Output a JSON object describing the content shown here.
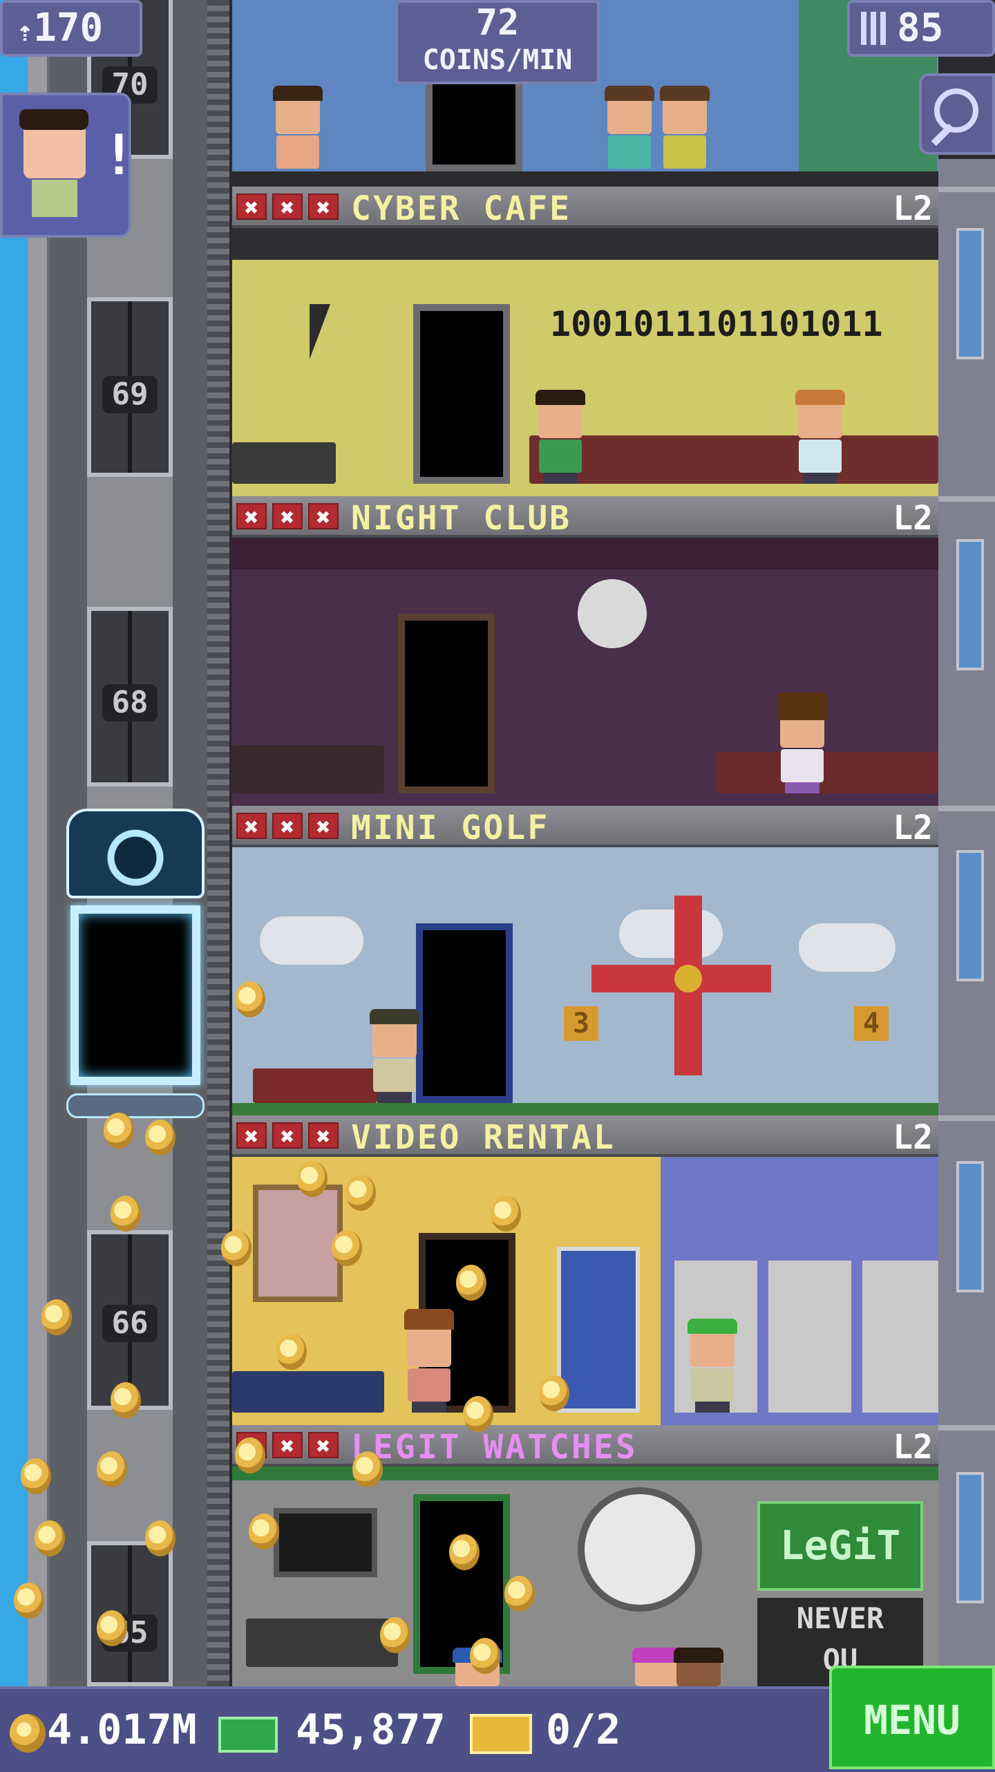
{
  "top_bar": {
    "population": "170",
    "coins_per_min_value": "72",
    "coins_per_min_label": "COINS/MIN",
    "floors_count": "85",
    "population_icon": "person-up-icon",
    "floors_icon": "building-icon",
    "search_icon": "magnifier-icon"
  },
  "notification": {
    "mark": "!"
  },
  "elevator_floor_numbers": [
    "70",
    "69",
    "68",
    "66",
    "65"
  ],
  "floors": [
    {
      "name": "CYBER CAFE",
      "level": "L2",
      "name_color": "#f3f1a2",
      "stock": [
        "✖",
        "✖",
        "✖"
      ],
      "screen_text": "1001011101101011"
    },
    {
      "name": "NIGHT CLUB",
      "level": "L2",
      "name_color": "#f3f1a2",
      "stock": [
        "✖",
        "✖",
        "✖"
      ]
    },
    {
      "name": "MINI GOLF",
      "level": "L2",
      "name_color": "#f3f1a2",
      "stock": [
        "✖",
        "✖",
        "✖"
      ],
      "hole_numbers": [
        "3",
        "4"
      ]
    },
    {
      "name": "VIDEO RENTAL",
      "level": "L2",
      "name_color": "#f3f1a2",
      "stock": [
        "✖",
        "✖",
        "✖"
      ]
    },
    {
      "name": "LEGIT WATCHES",
      "level": "L2",
      "name_color": "#e58ff0",
      "stock": [
        "✖",
        "✖",
        "✖"
      ],
      "sign_main": "LeGiT",
      "sign_sub": "NEVER",
      "sign_sub2": "OU"
    }
  ],
  "bottom_bar": {
    "coins": "4.017M",
    "bux": "45,877",
    "tickets": "0/2",
    "menu_label": "MENU",
    "coin_icon": "coin-icon",
    "bux_icon": "bux-cash-icon",
    "ticket_icon": "golden-ticket-icon"
  }
}
